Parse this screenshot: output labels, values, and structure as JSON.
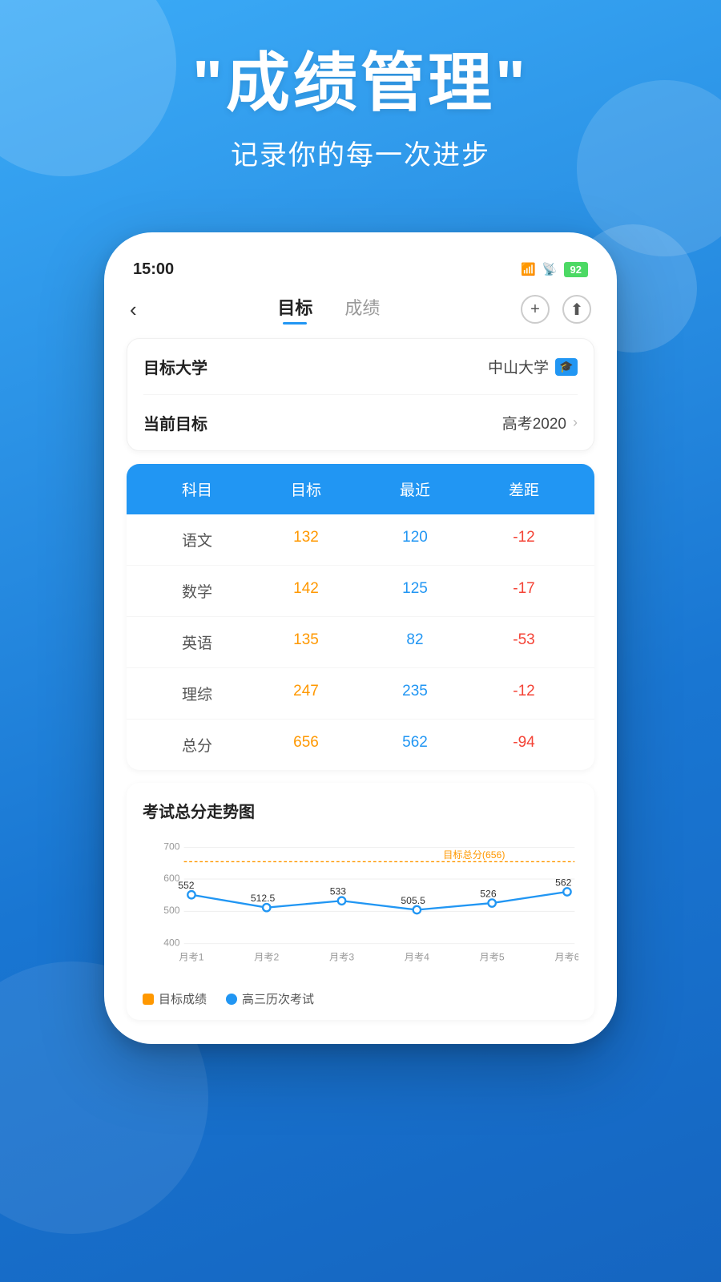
{
  "background": {
    "gradient_start": "#3babf7",
    "gradient_end": "#1565C0"
  },
  "hero": {
    "title": "\"成绩管理\"",
    "subtitle": "记录你的每一次进步"
  },
  "status_bar": {
    "time": "15:00",
    "signal": "HD",
    "wifi": "wifi",
    "battery": "92"
  },
  "nav": {
    "back_icon": "‹",
    "tab_active": "目标",
    "tab_inactive": "成绩",
    "add_icon": "+",
    "share_icon": "⬆"
  },
  "info": {
    "university_label": "目标大学",
    "university_value": "中山大学",
    "goal_label": "当前目标",
    "goal_value": "高考2020"
  },
  "table": {
    "headers": [
      "科目",
      "目标",
      "最近",
      "差距"
    ],
    "rows": [
      {
        "subject": "语文",
        "target": "132",
        "recent": "120",
        "diff": "-12"
      },
      {
        "subject": "数学",
        "target": "142",
        "recent": "125",
        "diff": "-17"
      },
      {
        "subject": "英语",
        "target": "135",
        "recent": "82",
        "diff": "-53"
      },
      {
        "subject": "理综",
        "target": "247",
        "recent": "235",
        "diff": "-12"
      },
      {
        "subject": "总分",
        "target": "656",
        "recent": "562",
        "diff": "-94"
      }
    ]
  },
  "chart": {
    "title": "考试总分走势图",
    "target_label": "目标总分(656)",
    "target_value": 656,
    "y_labels": [
      "700",
      "600",
      "500",
      "400"
    ],
    "x_labels": [
      "月考1",
      "月考2",
      "月考3",
      "月考4",
      "月考5",
      "月考6"
    ],
    "data_points": [
      552,
      512.5,
      533,
      505.5,
      526,
      562
    ],
    "legend": [
      {
        "label": "目标成绩",
        "color": "#FF9800"
      },
      {
        "label": "高三历次考试",
        "color": "#2196F3"
      }
    ]
  }
}
